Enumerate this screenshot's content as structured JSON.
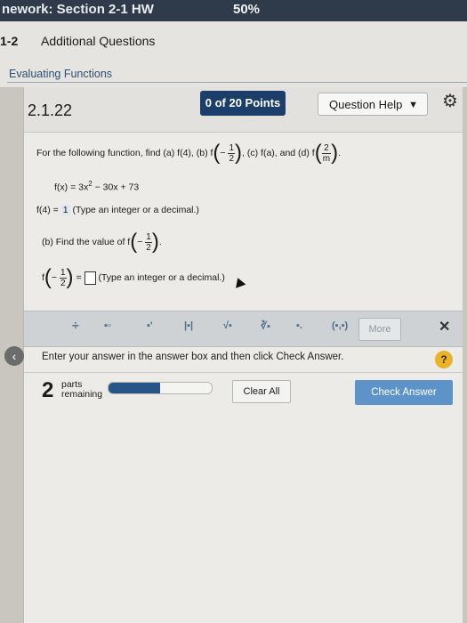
{
  "header": {
    "title": "nework: Section 2-1 HW",
    "score": "50%"
  },
  "breadcrumb": {
    "number": "1-2",
    "label": "Additional Questions"
  },
  "section": {
    "label": "Evaluating Functions"
  },
  "question": {
    "number": "2.1.22",
    "points": "0 of 20 Points",
    "help_label": "Question Help",
    "prompt_prefix": "For the following function, find (a) f(4), (b) f",
    "prompt_mid": ", (c) f(a), and (d) f",
    "frac_b": {
      "num": "1",
      "den": "2",
      "sign": "−"
    },
    "frac_d": {
      "num": "2",
      "den": "m"
    },
    "function_lhs": "f(x) = 3x",
    "function_exp": "2",
    "function_rhs": "− 30x + 73",
    "answer_a_label": "f(4) =",
    "answer_a_value": "1",
    "answer_a_hint": "(Type an integer or a decimal.)",
    "part_b_text": "(b) Find the value of f",
    "part_b_hint": "(Type an integer or a decimal.)"
  },
  "toolbar": {
    "more_label": "More"
  },
  "helpline": "Enter your answer in the answer box and then click Check Answer.",
  "parts": {
    "count": "2",
    "line1": "parts",
    "line2": "remaining",
    "progress": 0.5
  },
  "buttons": {
    "clear_all": "Clear All",
    "check_answer": "Check Answer"
  }
}
